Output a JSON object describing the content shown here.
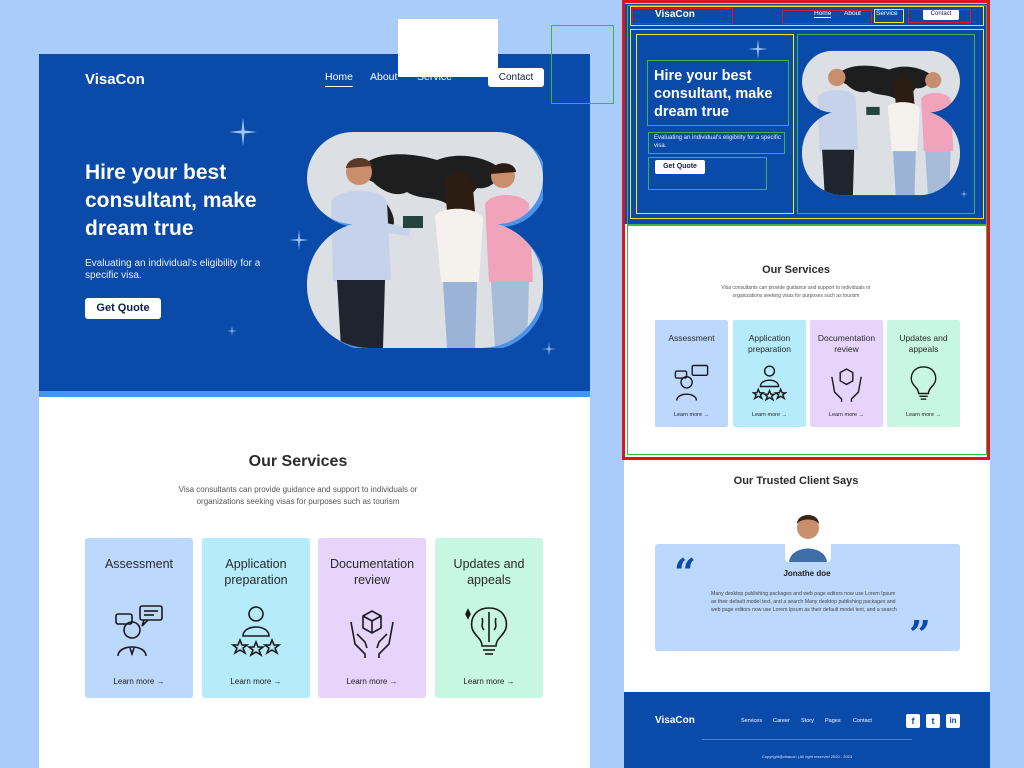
{
  "brand": "VisaCon",
  "nav": {
    "home": "Home",
    "about": "About",
    "service": "Service",
    "contact": "Contact"
  },
  "hero": {
    "headline": "Hire your best consultant, make dream true",
    "subtext": "Evaluating an individual's eligibility for a specific visa.",
    "cta": "Get Quote"
  },
  "services": {
    "title": "Our Services",
    "subtitle": "Visa consultants can provide guidance and support to individuals or organizations seeking visas for purposes such as tourism",
    "cards": [
      {
        "title": "Assessment",
        "link": "Learn more →",
        "color": "#bcd8fd",
        "icon": "consultant-chat-icon"
      },
      {
        "title": "Application preparation",
        "link": "Learn more →",
        "color": "#b5ebfb",
        "icon": "person-rating-stars-icon"
      },
      {
        "title": "Documentation review",
        "link": "Learn more →",
        "color": "#e7d4fb",
        "icon": "hands-box-icon"
      },
      {
        "title": "Updates and appeals",
        "link": "Learn more →",
        "color": "#c7f7e2",
        "icon": "brain-lightbulb-icon"
      }
    ]
  },
  "testimonials": {
    "title": "Our Trusted Client Says",
    "name": "Jonathe doe",
    "text": "Many desktop publishing packages and web page editors now use Lorem Ipsum as their default model text, and a search Many desktop publishing packages and web page editors now use Lorem Ipsum as their default model text, and a search",
    "open_quote": "“",
    "close_quote": "”"
  },
  "footer": {
    "brand": "VisaCon",
    "links": [
      "Services",
      "Career",
      "Story",
      "Pages",
      "Contact"
    ],
    "social": [
      "facebook-icon",
      "twitter-icon",
      "linkedin-icon"
    ],
    "social_glyphs": [
      "f",
      "t",
      "in"
    ],
    "copyright": "Copyright@visacon | All right reserved 2020 - 2023"
  },
  "colors": {
    "page_bg": "#a9ccfb",
    "primary": "#0a4aa8",
    "annotation_red": "#e0141e",
    "annotation_yellow": "#f5e820",
    "annotation_green": "#3fb34a"
  }
}
